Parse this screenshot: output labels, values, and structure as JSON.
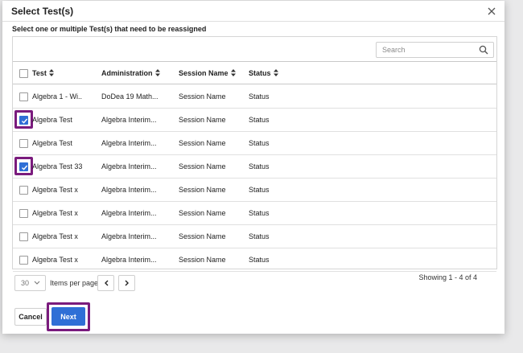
{
  "dialog": {
    "title": "Select Test(s)",
    "instruction": "Select one or multiple Test(s) that need to be reassigned"
  },
  "search": {
    "placeholder": "Search"
  },
  "table": {
    "columns": [
      "Test",
      "Administration",
      "Session Name",
      "Status"
    ],
    "rows": [
      {
        "test": "Algebra 1 - Wi..",
        "administration": "DoDea 19 Math...",
        "session": "Session Name",
        "status": "Status",
        "checked": false
      },
      {
        "test": "Algebra Test",
        "administration": "Algebra Interim...",
        "session": "Session Name",
        "status": "Status",
        "checked": true
      },
      {
        "test": "Algebra Test",
        "administration": "Algebra Interim...",
        "session": "Session Name",
        "status": "Status",
        "checked": false
      },
      {
        "test": "Algebra Test 33",
        "administration": "Algebra Interim...",
        "session": "Session Name",
        "status": "Status",
        "checked": true
      },
      {
        "test": "Algebra Test x",
        "administration": "Algebra Interim...",
        "session": "Session Name",
        "status": "Status",
        "checked": false
      },
      {
        "test": "Algebra Test x",
        "administration": "Algebra Interim...",
        "session": "Session Name",
        "status": "Status",
        "checked": false
      },
      {
        "test": "Algebra Test x",
        "administration": "Algebra Interim...",
        "session": "Session Name",
        "status": "Status",
        "checked": false
      },
      {
        "test": "Algebra Test x",
        "administration": "Algebra Interim...",
        "session": "Session Name",
        "status": "Status",
        "checked": false
      }
    ]
  },
  "pagination": {
    "page_size": "30",
    "items_per_page_label": "Items per page",
    "showing": "Showing 1 - 4 of 4"
  },
  "footer": {
    "cancel_label": "Cancel",
    "next_label": "Next"
  },
  "colors": {
    "accent": "#2f6fd6",
    "highlight": "#7a1b7d"
  },
  "icons": {
    "close": "close-icon",
    "search": "search-icon",
    "sort": "sort-icon",
    "check": "check-icon",
    "prev": "chevron-left-icon",
    "next": "chevron-right-icon",
    "dropdown": "chevron-down-icon"
  }
}
